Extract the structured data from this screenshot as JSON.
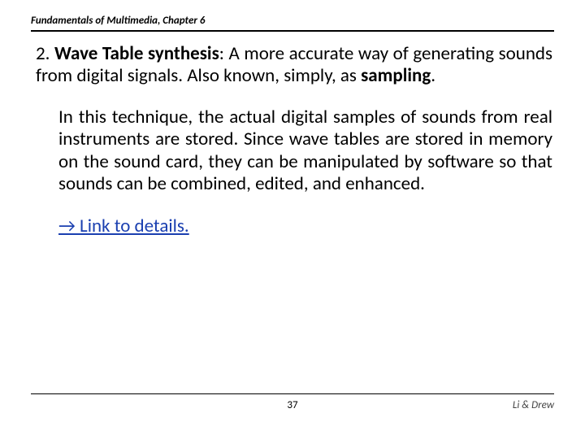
{
  "header": {
    "title": "Fundamentals of Multimedia, Chapter 6"
  },
  "body": {
    "item_number": "2. ",
    "item_title_bold": "Wave Table synthesis",
    "item_title_rest": ": A more accurate way of generating sounds from digital signals. Also known, simply, as ",
    "item_title_bold2": "sampling",
    "item_title_tail": ".",
    "paragraph2": "In this technique, the actual digital samples of sounds from real instruments are stored. Since wave tables are stored in memory on the sound card, they can be manipulated by software so that sounds can be combined, edited, and enhanced.",
    "link_text": "→ Link to details."
  },
  "footer": {
    "page_number": "37",
    "authors": "Li & Drew"
  }
}
